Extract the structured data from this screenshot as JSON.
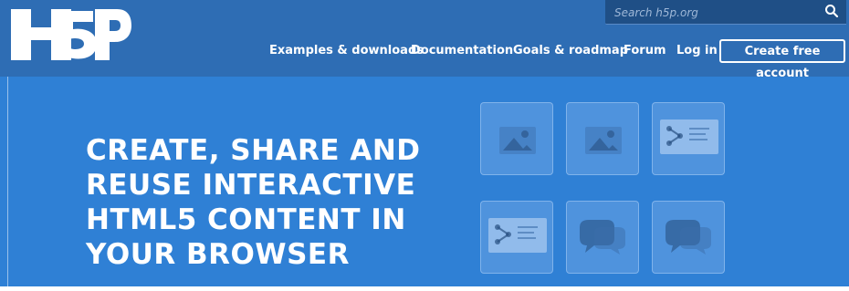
{
  "brand": {
    "logo_text": "H5P"
  },
  "search": {
    "placeholder": "Search h5p.org"
  },
  "nav": {
    "items": [
      {
        "label": "Examples & downloads"
      },
      {
        "label": "Documentation"
      },
      {
        "label": "Goals & roadmap"
      },
      {
        "label": "Forum"
      },
      {
        "label": "Log in"
      }
    ],
    "cta_label": "Create free account"
  },
  "hero": {
    "headline_lines": [
      "CREATE, SHARE AND",
      "REUSE INTERACTIVE",
      "HTML5 CONTENT IN",
      "YOUR BROWSER"
    ]
  },
  "tiles": [
    {
      "icon": "image-icon"
    },
    {
      "icon": "image-icon"
    },
    {
      "icon": "presentation-icon"
    },
    {
      "icon": "presentation-icon"
    },
    {
      "icon": "chat-bubbles-icon"
    },
    {
      "icon": "chat-bubbles-icon"
    }
  ],
  "colors": {
    "header_bg": "#2e6db4",
    "hero_bg": "#2f80d5",
    "search_bg": "#1f4f86",
    "text": "#ffffff"
  }
}
